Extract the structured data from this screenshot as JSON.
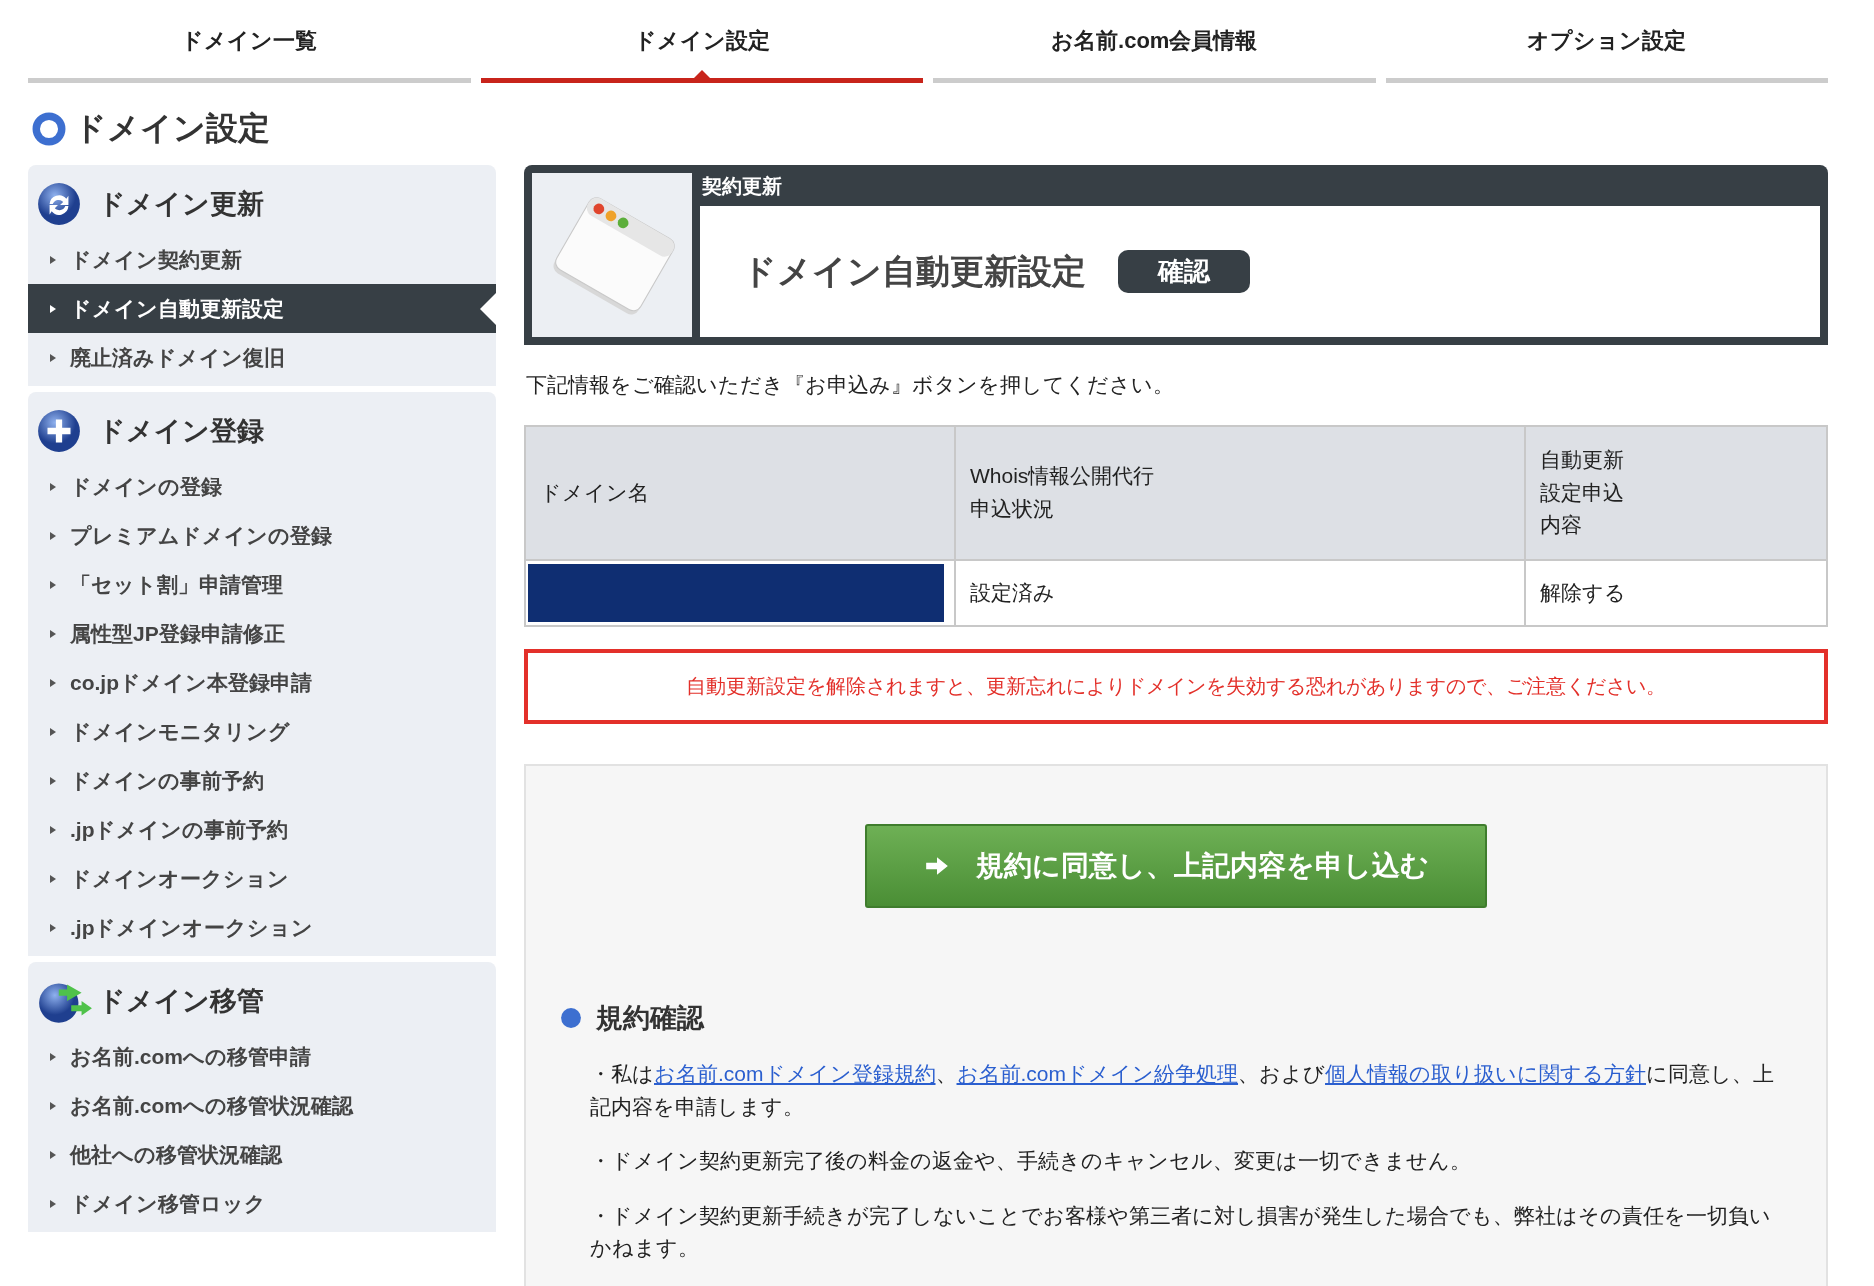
{
  "tabs": [
    {
      "label": "ドメイン一覧",
      "selected": false
    },
    {
      "label": "ドメイン設定",
      "selected": true
    },
    {
      "label": "お名前.com会員情報",
      "selected": false
    },
    {
      "label": "オプション設定",
      "selected": false
    }
  ],
  "page_title": "ドメイン設定",
  "sidebar": {
    "groups": [
      {
        "title": "ドメイン更新",
        "kind": "renew",
        "items": [
          {
            "label": "ドメイン契約更新",
            "selected": false
          },
          {
            "label": "ドメイン自動更新設定",
            "selected": true
          },
          {
            "label": "廃止済みドメイン復旧",
            "selected": false
          }
        ]
      },
      {
        "title": "ドメイン登録",
        "kind": "register",
        "items": [
          {
            "label": "ドメインの登録",
            "selected": false
          },
          {
            "label": "プレミアムドメインの登録",
            "selected": false
          },
          {
            "label": "「セット割」申請管理",
            "selected": false
          },
          {
            "label": "属性型JP登録申請修正",
            "selected": false
          },
          {
            "label": "co.jpドメイン本登録申請",
            "selected": false
          },
          {
            "label": "ドメインモニタリング",
            "selected": false
          },
          {
            "label": "ドメインの事前予約",
            "selected": false
          },
          {
            "label": ".jpドメインの事前予約",
            "selected": false
          },
          {
            "label": "ドメインオークション",
            "selected": false
          },
          {
            "label": ".jpドメインオークション",
            "selected": false
          }
        ]
      },
      {
        "title": "ドメイン移管",
        "kind": "transfer",
        "items": [
          {
            "label": "お名前.comへの移管申請",
            "selected": false
          },
          {
            "label": "お名前.comへの移管状況確認",
            "selected": false
          },
          {
            "label": "他社への移管状況確認",
            "selected": false
          },
          {
            "label": "ドメイン移管ロック",
            "selected": false
          }
        ]
      }
    ]
  },
  "header_card": {
    "category": "契約更新",
    "title": "ドメイン自動更新設定",
    "step": "確認"
  },
  "instruction": "下記情報をご確認いただき『お申込み』ボタンを押してください。",
  "table": {
    "columns": [
      "ドメイン名",
      "Whois情報公開代行申込状況",
      "自動更新設定申込内容"
    ],
    "rows": [
      {
        "cells": [
          {
            "kind": "redacted"
          },
          {
            "kind": "text",
            "text": "設定済み"
          },
          {
            "kind": "text",
            "text": "解除する"
          }
        ]
      }
    ]
  },
  "warning": "自動更新設定を解除されますと、更新忘れによりドメインを失効する恐れがありますので、ご注意ください。",
  "submit_button": "規約に同意し、上記内容を申し込む",
  "terms": {
    "title": "規約確認",
    "items": [
      [
        {
          "text": "・私は"
        },
        {
          "text": "お名前.comドメイン登録規約",
          "link": true
        },
        {
          "text": "、"
        },
        {
          "text": "お名前.comドメイン紛争処理",
          "link": true
        },
        {
          "text": "、および"
        },
        {
          "text": "個人情報の取り扱いに関する方針",
          "link": true
        },
        {
          "text": "に同意し、上記内容を申請します。"
        }
      ],
      [
        {
          "text": "・ドメイン契約更新完了後の料金の返金や、手続きのキャンセル、変更は一切できません。"
        }
      ],
      [
        {
          "text": "・ドメイン契約更新手続きが完了しないことでお客様や第三者に対し損害が発生した場合でも、弊社はその責任を一切負いかねます。"
        }
      ]
    ]
  }
}
